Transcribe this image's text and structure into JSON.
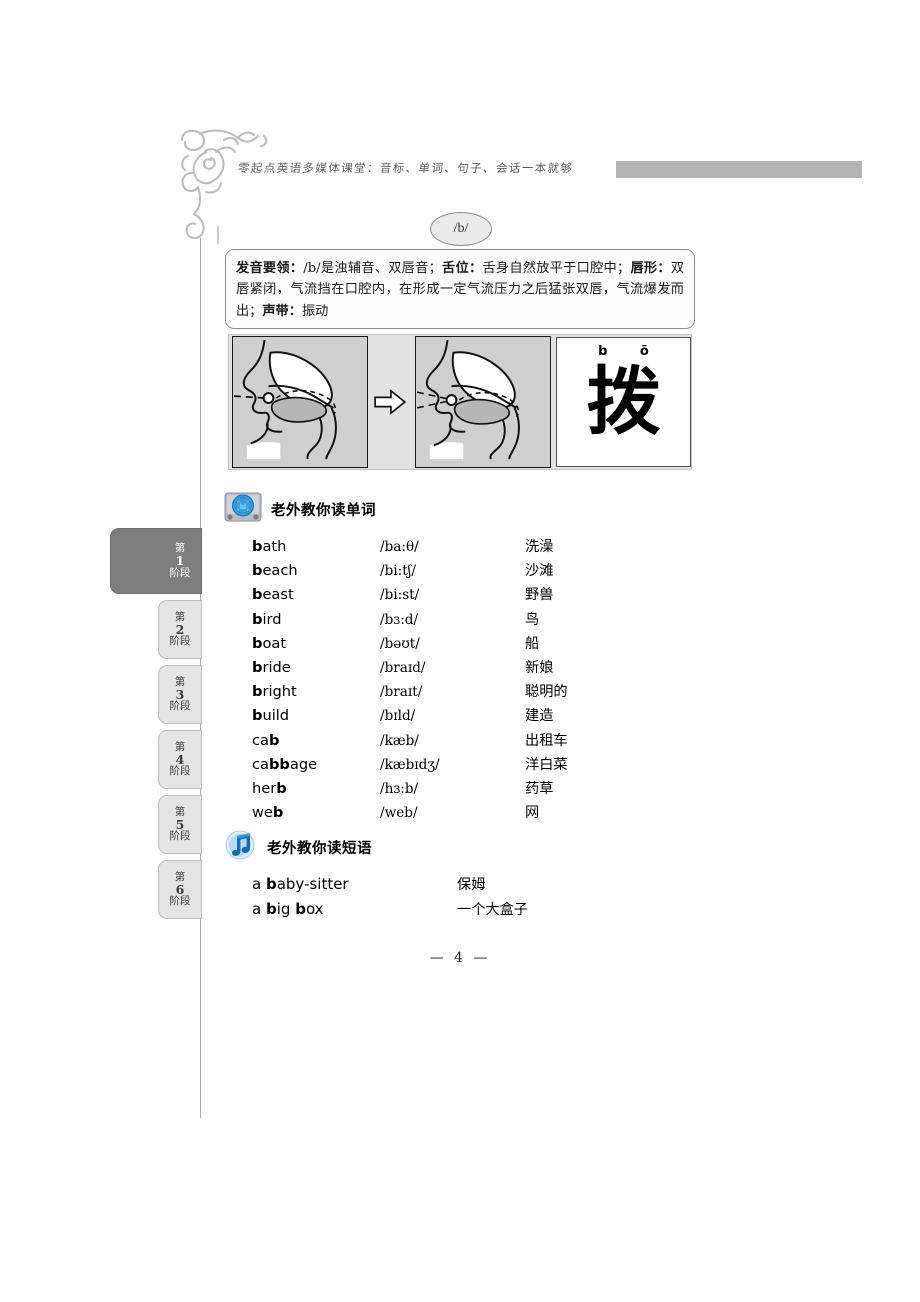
{
  "header": {
    "title": "零起点英语多媒体课堂：音标、单词、句子、会话一本就够",
    "ornament_icon": "floral-scroll-ornament",
    "bar_color": "#b4b4b4"
  },
  "phoneme": {
    "symbol": "/b/"
  },
  "description": {
    "label_1": "发音要领：",
    "body_1": "/b/是浊辅音、双唇音；",
    "label_2": "舌位：",
    "body_2": "舌身自然放平于口腔中；",
    "label_3": "唇形：",
    "body_3": "双唇紧闭，气流挡在口腔内，在形成一定气流压力之后猛张双唇，气流爆发而出；",
    "label_4": "声带：",
    "body_4": "振动"
  },
  "diagram": {
    "cell_1_icon": "mouth-cross-section-closed",
    "arrow_icon": "right-arrow-outline",
    "cell_2_icon": "mouth-cross-section-release",
    "hanzi_pinyin": "b ō",
    "hanzi_char": "拨"
  },
  "words_section": {
    "icon": "media-player-icon",
    "heading": "老外教你读单词",
    "entries": [
      {
        "prefix": "b",
        "rest": "ath",
        "bold_pos": "start",
        "ipa": "/ba:θ/",
        "cn": "洗澡"
      },
      {
        "prefix": "b",
        "rest": "each",
        "bold_pos": "start",
        "ipa": "/bi:tʃ/",
        "cn": "沙滩"
      },
      {
        "prefix": "b",
        "rest": "east",
        "bold_pos": "start",
        "ipa": "/bi:st/",
        "cn": "野兽"
      },
      {
        "prefix": "b",
        "rest": "ird",
        "bold_pos": "start",
        "ipa": "/bɜ:d/",
        "cn": "鸟"
      },
      {
        "prefix": "b",
        "rest": "oat",
        "bold_pos": "start",
        "ipa": "/bəʊt/",
        "cn": "船"
      },
      {
        "prefix": "b",
        "rest": "ride",
        "bold_pos": "start",
        "ipa": "/braɪd/",
        "cn": "新娘"
      },
      {
        "prefix": "b",
        "rest": "right",
        "bold_pos": "start",
        "ipa": "/braɪt/",
        "cn": "聪明的"
      },
      {
        "prefix": "b",
        "rest": "uild",
        "bold_pos": "start",
        "ipa": "/bɪld/",
        "cn": "建造"
      },
      {
        "prefix": "ca",
        "rest": "b",
        "bold_pos": "end",
        "ipa": "/kæb/",
        "cn": "出租车"
      },
      {
        "prefix": "ca",
        "rest": "bb",
        "bold_pos": "mid",
        "suffix": "age",
        "ipa": "/kæbɪdʒ/",
        "cn": "洋白菜"
      },
      {
        "prefix": "her",
        "rest": "b",
        "bold_pos": "end",
        "ipa": "/hɜ:b/",
        "cn": "药草"
      },
      {
        "prefix": "we",
        "rest": "b",
        "bold_pos": "end",
        "ipa": "/web/",
        "cn": "网"
      }
    ]
  },
  "phrases_section": {
    "icon": "music-note-icon",
    "heading": "老外教你读短语",
    "entries": [
      {
        "pre": "a ",
        "bold": "b",
        "post": "aby-sitter",
        "cn": "保姆"
      },
      {
        "pre": "a ",
        "bold": "b",
        "post": "ig ",
        "bold2": "b",
        "post2": "ox",
        "cn": "一个大盒子"
      }
    ]
  },
  "page_number": "— 4 —",
  "sidebar": {
    "stage_label_top": "第",
    "stage_label_bottom": "阶段",
    "tabs": [
      {
        "num": "1",
        "label": "第1阶段",
        "active": true
      },
      {
        "num": "2",
        "label": "第2阶段",
        "active": false
      },
      {
        "num": "3",
        "label": "第3阶段",
        "active": false
      },
      {
        "num": "4",
        "label": "第4阶段",
        "active": false
      },
      {
        "num": "5",
        "label": "第5阶段",
        "active": false
      },
      {
        "num": "6",
        "label": "第6阶段",
        "active": false
      }
    ]
  },
  "colors": {
    "active_tab": "#7e7e7e",
    "inactive_tab": "#e4e4e4",
    "diagram_bg": "#e2e2e2",
    "mouth_fill": "#cfcfcf"
  }
}
